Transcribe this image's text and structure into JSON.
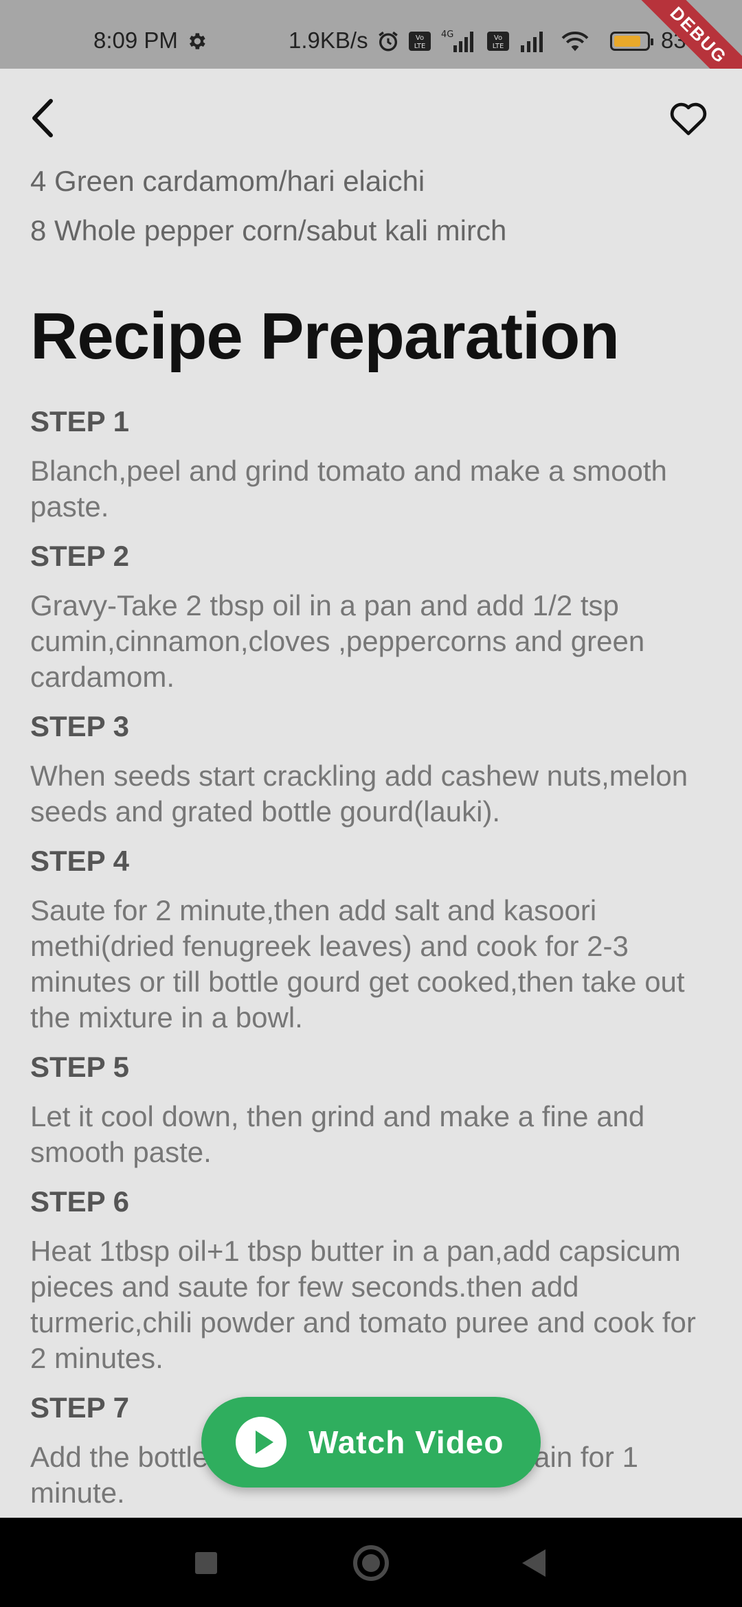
{
  "status_bar": {
    "time": "8:09 PM",
    "network_speed": "1.9KB/s",
    "lte_badge": "Vo LTE",
    "net_type": "4G",
    "battery_pct": "83%",
    "battery_level": 0.83,
    "debug_label": "DEBUG"
  },
  "app_bar": {
    "back_icon": "back-arrow-icon",
    "favorite_icon": "heart-outline-icon"
  },
  "ingredients": [
    "4 Green cardamom/hari elaichi",
    "8 Whole pepper corn/sabut kali mirch"
  ],
  "section_title": "Recipe Preparation",
  "steps": [
    {
      "title": "STEP 1",
      "text": "Blanch,peel and grind tomato and make a smooth paste."
    },
    {
      "title": "STEP 2",
      "text": "Gravy-Take 2 tbsp oil in a pan and add 1/2 tsp cumin,cinnamon,cloves ,peppercorns and green cardamom."
    },
    {
      "title": "STEP 3",
      "text": "When seeds start crackling add cashew nuts,melon seeds and grated bottle gourd(lauki)."
    },
    {
      "title": "STEP 4",
      "text": "Saute for 2 minute,then add salt and kasoori methi(dried fenugreek leaves) and cook for 2-3 minutes or till bottle gourd get cooked,then take out the mixture in a bowl."
    },
    {
      "title": "STEP 5",
      "text": "Let it cool down, then grind and make a fine and smooth paste."
    },
    {
      "title": "STEP 6",
      "text": "Heat 1tbsp oil+1 tbsp butter in a pan,add capsicum pieces and saute for few seconds.then add turmeric,chili powder and tomato puree and cook for 2 minutes."
    },
    {
      "title": "STEP 7",
      "text": "Add the bottle gourd gravy and cook again for 1 minute."
    }
  ],
  "watch_video": {
    "label": "Watch Video",
    "icon": "play-circle-icon",
    "color": "#2fae5e"
  },
  "nav_bar": {
    "recents_icon": "square-icon",
    "home_icon": "circle-icon",
    "back_icon": "triangle-back-icon"
  }
}
